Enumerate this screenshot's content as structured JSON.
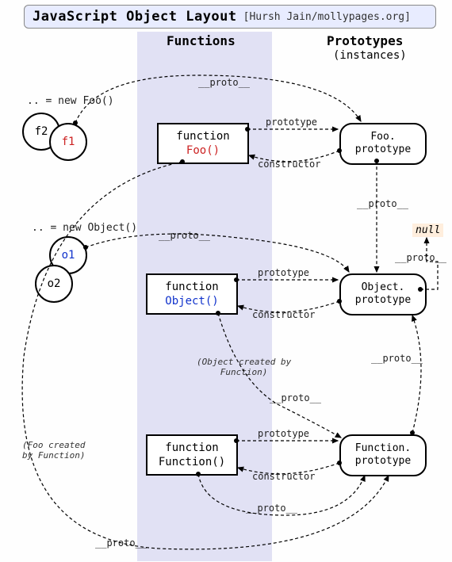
{
  "header": {
    "title": "JavaScript Object Layout",
    "credit": "[Hursh Jain/mollypages.org]"
  },
  "columns": {
    "functions": "Functions",
    "prototypes": "Prototypes",
    "prototypes_sub": "(instances)"
  },
  "instances": {
    "foo_new": ".. = new Foo()",
    "f1": "f1",
    "f2": "f2",
    "obj_new": ".. = new Object()",
    "o1": "o1",
    "o2": "o2"
  },
  "functions": {
    "foo_kw": "function",
    "foo_name": "Foo()",
    "object_kw": "function",
    "object_name": "Object()",
    "function_kw": "function",
    "function_name": "Function()"
  },
  "prototypes": {
    "foo": "Foo.\nprototype",
    "object": "Object.\nprototype",
    "function": "Function.\nprototype"
  },
  "labels": {
    "proto": "__proto__",
    "prototype": "prototype",
    "constructor": "constructor",
    "null": "null"
  },
  "notes": {
    "object_created": "(Object created by\nFunction)",
    "foo_created": "(Foo created\nby Function)"
  }
}
